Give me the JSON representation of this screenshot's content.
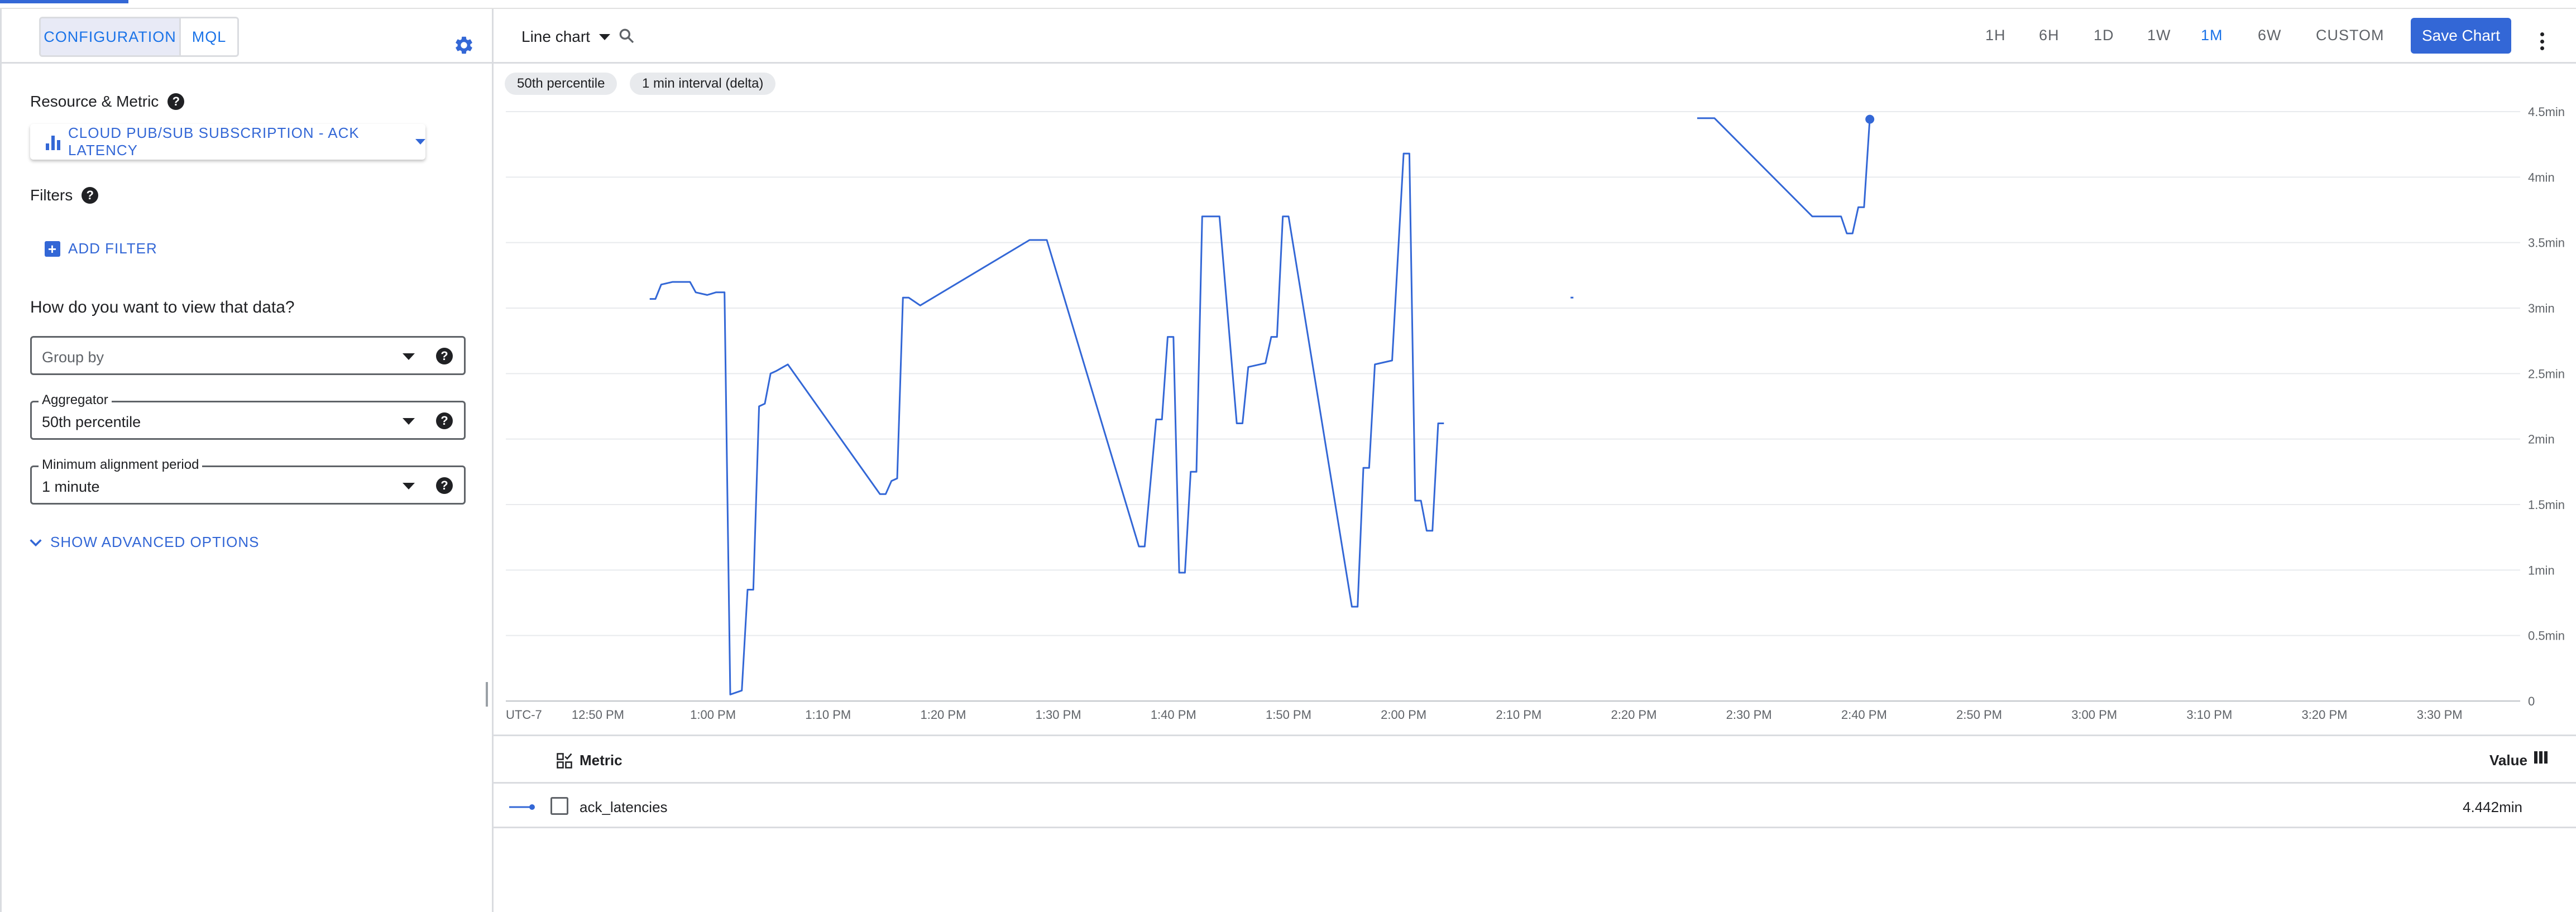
{
  "panel": {
    "tabs": [
      {
        "label": "CONFIGURATION",
        "active": true
      },
      {
        "label": "MQL",
        "active": false
      }
    ],
    "resource_label": "Resource & Metric",
    "resource_value": "CLOUD PUB/SUB SUBSCRIPTION - ACK LATENCY",
    "filters_label": "Filters",
    "add_filter": "ADD FILTER",
    "view_heading": "How do you want to view that data?",
    "group_by": {
      "placeholder": "Group by"
    },
    "aggregator": {
      "label": "Aggregator",
      "value": "50th percentile"
    },
    "alignment": {
      "label": "Minimum alignment period",
      "value": "1 minute"
    },
    "advanced": "SHOW ADVANCED OPTIONS"
  },
  "toolbar": {
    "chart_type": "Line chart",
    "ranges": [
      {
        "label": "1H",
        "active": false
      },
      {
        "label": "6H",
        "active": false
      },
      {
        "label": "1D",
        "active": false
      },
      {
        "label": "1W",
        "active": false
      },
      {
        "label": "1M",
        "active": true
      },
      {
        "label": "6W",
        "active": false
      },
      {
        "label": "CUSTOM",
        "active": false
      }
    ],
    "save_label": "Save Chart"
  },
  "chips": [
    "50th percentile",
    "1 min interval (delta)"
  ],
  "colors": {
    "accent": "#3367d6",
    "series": "#3367d6",
    "grid": "#e8eaed"
  },
  "chart_data": {
    "type": "line",
    "timezone_label": "UTC-7",
    "x_ticks": [
      "12:50 PM",
      "1:00 PM",
      "1:10 PM",
      "1:20 PM",
      "1:30 PM",
      "1:40 PM",
      "1:50 PM",
      "2:00 PM",
      "2:10 PM",
      "2:20 PM",
      "2:30 PM",
      "2:40 PM",
      "2:50 PM",
      "3:00 PM",
      "3:10 PM",
      "3:20 PM",
      "3:30 PM"
    ],
    "y_ticks": [
      "0",
      "0.5min",
      "1min",
      "1.5min",
      "2min",
      "2.5min",
      "3min",
      "3.5min",
      "4min",
      "4.5min"
    ],
    "ylim": [
      0,
      4.5
    ],
    "y_unit": "min",
    "x_range": [
      "12:42 PM",
      "3:37 PM"
    ],
    "grid": true,
    "series": [
      {
        "name": "ack_latencies",
        "segments": [
          [
            [
              "12:54:30",
              3.07
            ],
            [
              "12:55:00",
              3.07
            ],
            [
              "12:55:30",
              3.18
            ],
            [
              "12:56:30",
              3.2
            ],
            [
              "12:58:00",
              3.2
            ],
            [
              "12:58:30",
              3.12
            ],
            [
              "12:59:30",
              3.1
            ],
            [
              "1:00:15",
              3.12
            ],
            [
              "1:01:00",
              3.12
            ],
            [
              "1:01:30",
              0.05
            ],
            [
              "1:02:30",
              0.08
            ],
            [
              "1:03:00",
              0.85
            ],
            [
              "1:03:30",
              0.85
            ],
            [
              "1:04:00",
              2.25
            ],
            [
              "1:04:30",
              2.27
            ],
            [
              "1:05:00",
              2.5
            ],
            [
              "1:05:30",
              2.52
            ],
            [
              "1:06:30",
              2.57
            ],
            [
              "1:14:30",
              1.58
            ],
            [
              "1:15:00",
              1.58
            ],
            [
              "1:15:30",
              1.68
            ],
            [
              "1:16:00",
              1.7
            ],
            [
              "1:16:30",
              3.08
            ],
            [
              "1:17:00",
              3.08
            ],
            [
              "1:18:00",
              3.02
            ],
            [
              "1:27:30",
              3.52
            ],
            [
              "1:29:00",
              3.52
            ],
            [
              "1:37:00",
              1.18
            ],
            [
              "1:37:30",
              1.18
            ],
            [
              "1:38:30",
              2.15
            ],
            [
              "1:39:00",
              2.15
            ],
            [
              "1:39:30",
              2.78
            ],
            [
              "1:40:00",
              2.78
            ],
            [
              "1:40:30",
              0.98
            ],
            [
              "1:41:00",
              0.98
            ],
            [
              "1:41:30",
              1.75
            ],
            [
              "1:42:00",
              1.75
            ],
            [
              "1:42:30",
              3.7
            ],
            [
              "1:44:00",
              3.7
            ],
            [
              "1:45:30",
              2.12
            ],
            [
              "1:46:00",
              2.12
            ],
            [
              "1:46:30",
              2.55
            ],
            [
              "1:47:30",
              2.57
            ],
            [
              "1:48:00",
              2.58
            ],
            [
              "1:48:30",
              2.78
            ],
            [
              "1:49:00",
              2.78
            ],
            [
              "1:49:30",
              3.7
            ],
            [
              "1:50:00",
              3.7
            ],
            [
              "1:55:30",
              0.72
            ],
            [
              "1:56:00",
              0.72
            ],
            [
              "1:56:30",
              1.78
            ],
            [
              "1:57:00",
              1.78
            ],
            [
              "1:57:30",
              2.57
            ],
            [
              "1:59:00",
              2.6
            ],
            [
              "2:00:00",
              4.18
            ],
            [
              "2:00:30",
              4.18
            ],
            [
              "2:01:00",
              1.53
            ],
            [
              "2:01:30",
              1.53
            ],
            [
              "2:02:00",
              1.3
            ],
            [
              "2:02:30",
              1.3
            ],
            [
              "2:03:00",
              2.12
            ],
            [
              "2:03:30",
              2.12
            ]
          ],
          [
            [
              "2:14:30",
              3.08
            ],
            [
              "2:14:45",
              3.08
            ]
          ],
          [
            [
              "2:25:30",
              4.45
            ],
            [
              "2:27:00",
              4.45
            ],
            [
              "2:35:30",
              3.7
            ],
            [
              "2:38:00",
              3.7
            ],
            [
              "2:38:30",
              3.57
            ],
            [
              "2:39:00",
              3.57
            ],
            [
              "2:39:30",
              3.77
            ],
            [
              "2:40:00",
              3.77
            ],
            [
              "2:40:30",
              4.45
            ]
          ]
        ],
        "last_point": [
          "2:40:30",
          4.442
        ]
      }
    ]
  },
  "legend": {
    "metric_header": "Metric",
    "value_header": "Value",
    "rows": [
      {
        "name": "ack_latencies",
        "value": "4.442min"
      }
    ]
  }
}
